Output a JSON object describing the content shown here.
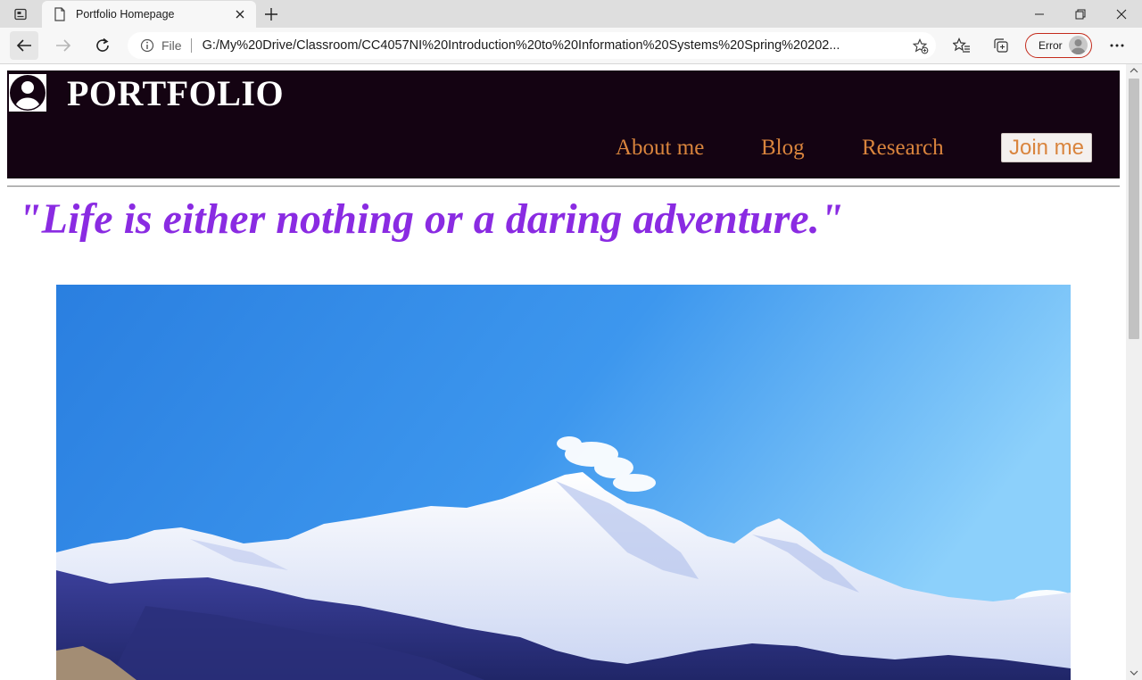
{
  "browser": {
    "tab_title": "Portfolio Homepage",
    "address_scheme": "File",
    "address_url": "G:/My%20Drive/Classroom/CC4057NI%20Introduction%20to%20Information%20Systems%20Spring%20202...",
    "profile_status": "Error"
  },
  "site": {
    "title": "PORTFOLIO",
    "nav": {
      "about": "About me",
      "blog": "Blog",
      "research": "Research",
      "join": "Join me"
    },
    "quote": "\"Life is either nothing or a daring adventure.\""
  },
  "colors": {
    "header_bg": "#140312",
    "nav_link": "#d9843d",
    "quote": "#8a2be2",
    "error_border": "#c42b1c"
  },
  "icons": [
    "tab-actions-icon",
    "page-icon",
    "close-icon",
    "plus-icon",
    "minimize-icon",
    "restore-icon",
    "window-close-icon",
    "back-arrow-icon",
    "forward-arrow-icon",
    "reload-icon",
    "info-icon",
    "add-favorite-icon",
    "favorites-icon",
    "collections-icon",
    "avatar-icon",
    "more-icon",
    "user-profile-icon"
  ]
}
